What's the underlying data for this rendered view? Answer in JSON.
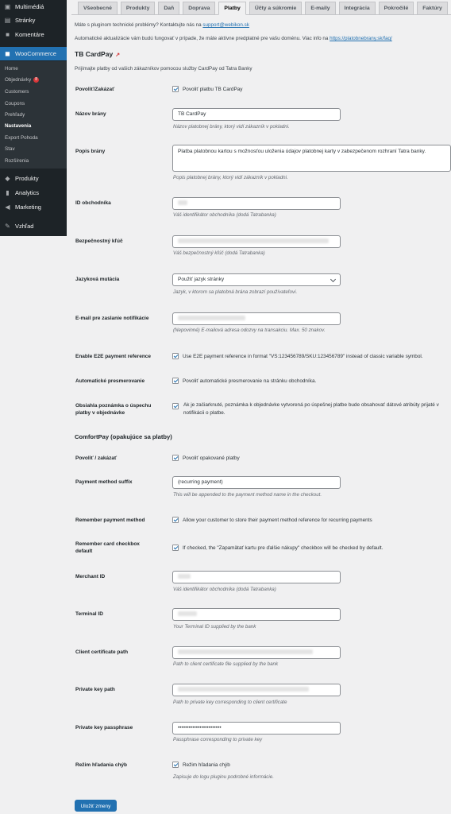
{
  "sidebar": {
    "items": [
      {
        "label": "Multimédiá",
        "icon": "media-icon"
      },
      {
        "label": "Stránky",
        "icon": "pages-icon"
      },
      {
        "label": "Komentáre",
        "icon": "comments-icon"
      },
      {
        "label": "WooCommerce",
        "icon": "woocommerce-icon"
      },
      {
        "label": "Produkty",
        "icon": "products-icon"
      },
      {
        "label": "Analytics",
        "icon": "analytics-icon"
      },
      {
        "label": "Marketing",
        "icon": "marketing-icon"
      },
      {
        "label": "Vzhľad",
        "icon": "appearance-icon"
      }
    ],
    "submenu": [
      "Home",
      "Objednávky",
      "Customers",
      "Coupons",
      "Prehľady",
      "Nastavenia",
      "Export Pohoda",
      "Stav",
      "Rozšírenia"
    ],
    "orders_badge": "8",
    "active_submenu": "Nastavenia"
  },
  "tabs": [
    "Všeobecné",
    "Produkty",
    "Daň",
    "Doprava",
    "Platby",
    "Účty a súkromie",
    "E-maily",
    "Integrácia",
    "Pokročilé",
    "Faktúry"
  ],
  "active_tab": "Platby",
  "notices": {
    "line1_prefix": "Máte s pluginom technické problémy? Kontaktujte nás na",
    "line1_link": "support@webikon.sk",
    "line2_prefix": "Automatické aktualizácie vám budú fungovať v prípade, že máte aktívne predplatné pre vašu doménu. Viac info na",
    "line2_link": "https://platobnebrany.sk/faq/"
  },
  "section_title": "TB CardPay",
  "section_desc": "Prijímajte platby od vašich zákazníkov pomocou služby CardPay od Tatra Banky",
  "fields": {
    "enable": {
      "label": "Povoliť/Zakázať",
      "check": "Povoliť platbu TB CardPay"
    },
    "title": {
      "label": "Názov brány",
      "value": "TB CardPay",
      "desc": "Názov platobnej brány, ktorý vidí zákazník v pokladni."
    },
    "description": {
      "label": "Popis brány",
      "value": "Platba platobnou kartou s možnosťou uloženia údajov platobnej karty v zabezpečenom rozhraní Tatra banky.",
      "desc": "Popis platobnej brány, ktorý vidí zákazník v pokladni."
    },
    "merchant": {
      "label": "ID obchodníka",
      "desc": "Váš identifikátor obchodníka (dodá Tatrabanka)"
    },
    "secret": {
      "label": "Bezpečnostný kľúč",
      "desc": "Váš bezpečnostný kľúč (dodá Tatrabanka)"
    },
    "language": {
      "label": "Jazyková mutácia",
      "value": "Použiť jazyk stránky",
      "desc": "Jazyk, v ktorom sa platobná brána zobrazí používateľovi."
    },
    "email": {
      "label": "E-mail pre zaslanie notifikácie",
      "desc": "(Nepovinné) E-mailová adresa odozvy na transakciu. Max. 50 znakov."
    },
    "e2e": {
      "label": "Enable E2E payment reference",
      "check": "Use E2E payment reference in format \"VS:123456789/SKU:123456789\" instead of classic variable symbol."
    },
    "redirect": {
      "label": "Automatické presmerovanie",
      "check": "Povoliť automatické presmerovanie na stránku obchodníka."
    },
    "note": {
      "label": "Obsiahla poznámka o úspechu platby v objednávke",
      "check": "Ak je začiarknuté, poznámka k objednávke vytvorená po úspešnej platbe bude obsahovať dátové atribúty prijaté v notifikácii o platbe."
    }
  },
  "comfortpay_title": "ComfortPay (opakujúce sa platby)",
  "comfortpay": {
    "enable": {
      "label": "Povoliť / zakázať",
      "check": "Povoliť opakované platby"
    },
    "suffix": {
      "label": "Payment method suffix",
      "value": "(recurring payment)",
      "desc": "This will be appended to the payment method name in the checkout."
    },
    "remember": {
      "label": "Remember payment method",
      "check": "Allow your customer to store their payment method reference for recurring payments"
    },
    "remember_default": {
      "label": "Remember card checkbox default",
      "check": "If checked, the \"Zapamätať kartu pre ďalšie nákupy\" checkbox will be checked by default."
    },
    "merchant": {
      "label": "Merchant ID",
      "desc": "Váš identifikátor obchodníka (dodá Tatrabanka)"
    },
    "terminal": {
      "label": "Terminal ID",
      "desc": "Your Terminal ID supplied by the bank"
    },
    "cert": {
      "label": "Client certificate path",
      "desc": "Path to client certificate file supplied by the bank"
    },
    "key": {
      "label": "Private key path",
      "desc": "Path to private key corresponding to client certificate"
    },
    "pass": {
      "label": "Private key passphrase",
      "value": "••••••••••••••••••••••••",
      "desc": "Passphrase corresponding to private key"
    },
    "debug": {
      "label": "Režim hľadania chýb",
      "check": "Režim hľadania chýb",
      "desc": "Zapisuje do logu pluginu podrobné informácie."
    }
  },
  "save_button": "Uložiť zmeny",
  "colors": {
    "accent": "#2271b1",
    "sidebar": "#1d2327",
    "badge": "#d63638"
  }
}
